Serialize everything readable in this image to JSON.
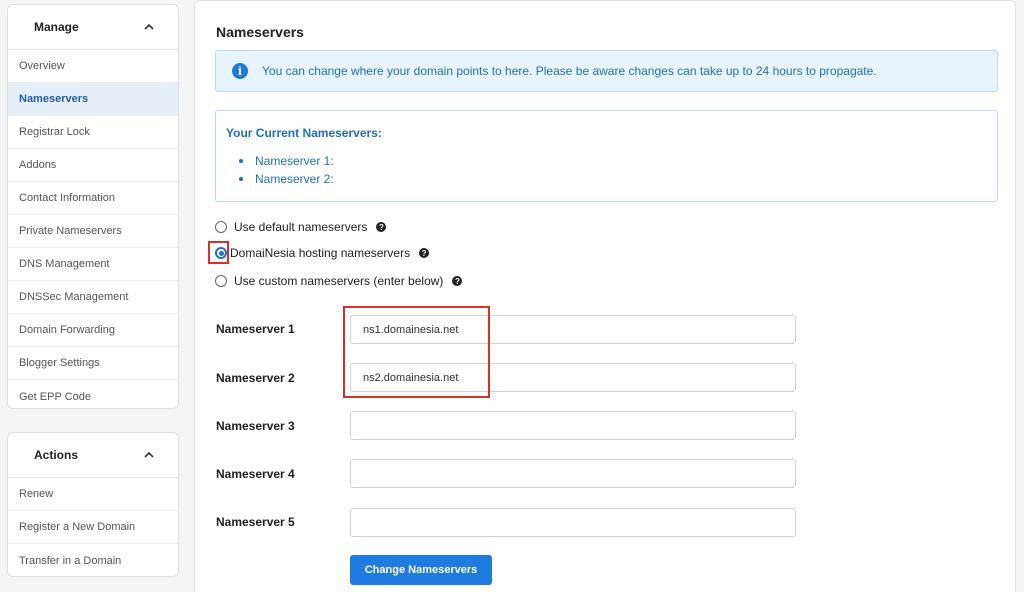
{
  "sidebar": {
    "manage": {
      "title": "Manage",
      "items": [
        {
          "label": "Overview"
        },
        {
          "label": "Nameservers"
        },
        {
          "label": "Registrar Lock"
        },
        {
          "label": "Addons"
        },
        {
          "label": "Contact Information"
        },
        {
          "label": "Private Nameservers"
        },
        {
          "label": "DNS Management"
        },
        {
          "label": "DNSSec Management"
        },
        {
          "label": "Domain Forwarding"
        },
        {
          "label": "Blogger Settings"
        },
        {
          "label": "Get EPP Code"
        }
      ],
      "active_index": 1
    },
    "actions": {
      "title": "Actions",
      "items": [
        {
          "label": "Renew"
        },
        {
          "label": "Register a New Domain"
        },
        {
          "label": "Transfer in a Domain"
        }
      ]
    }
  },
  "main": {
    "title": "Nameservers",
    "alert": {
      "icon": "info-icon",
      "text": "You can change where your domain points to here. Please be aware changes can take up to 24 hours to propagate."
    },
    "current": {
      "title": "Your Current Nameservers:",
      "items": [
        "Nameserver 1:",
        "Nameserver 2:"
      ]
    },
    "options": [
      {
        "label": "Use default nameservers",
        "checked": false
      },
      {
        "label": "DomaiNesia hosting nameservers",
        "checked": true
      },
      {
        "label": "Use custom nameservers (enter below)",
        "checked": false
      }
    ],
    "fields": [
      {
        "label": "Nameserver 1",
        "value": "ns1.domainesia.net"
      },
      {
        "label": "Nameserver 2",
        "value": "ns2.domainesia.net"
      },
      {
        "label": "Nameserver 3",
        "value": ""
      },
      {
        "label": "Nameserver 4",
        "value": ""
      },
      {
        "label": "Nameserver 5",
        "value": ""
      }
    ],
    "submit_label": "Change Nameservers"
  },
  "colors": {
    "accent": "#1e7be0",
    "active_bg": "#e6eef8",
    "info_text": "#1f6fc7",
    "highlight": "#d9302c"
  }
}
